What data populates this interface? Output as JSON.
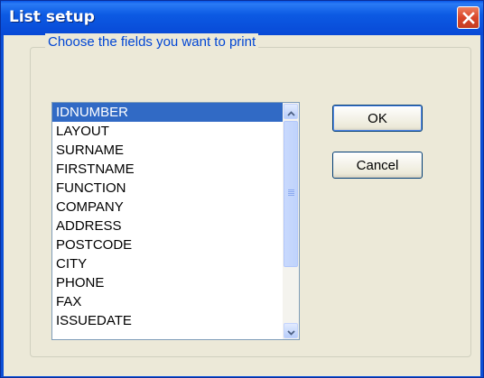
{
  "window": {
    "title": "List setup"
  },
  "group": {
    "legend": "Choose the fields you want to print"
  },
  "fields": [
    "IDNUMBER",
    "LAYOUT",
    "SURNAME",
    "FIRSTNAME",
    "FUNCTION",
    "COMPANY",
    "ADDRESS",
    "POSTCODE",
    "CITY",
    "PHONE",
    "FAX",
    "ISSUEDATE"
  ],
  "selected_field": "IDNUMBER",
  "buttons": {
    "ok": "OK",
    "cancel": "Cancel"
  },
  "icons": {
    "close": "close-icon",
    "scroll_up": "chevron-up-icon",
    "scroll_down": "chevron-down-icon"
  },
  "colors": {
    "titlebar": "#0a57e8",
    "selection": "#316ac5",
    "dialog_bg": "#ece9d8",
    "legend_text": "#0046d5",
    "close_button": "#d8462a"
  }
}
